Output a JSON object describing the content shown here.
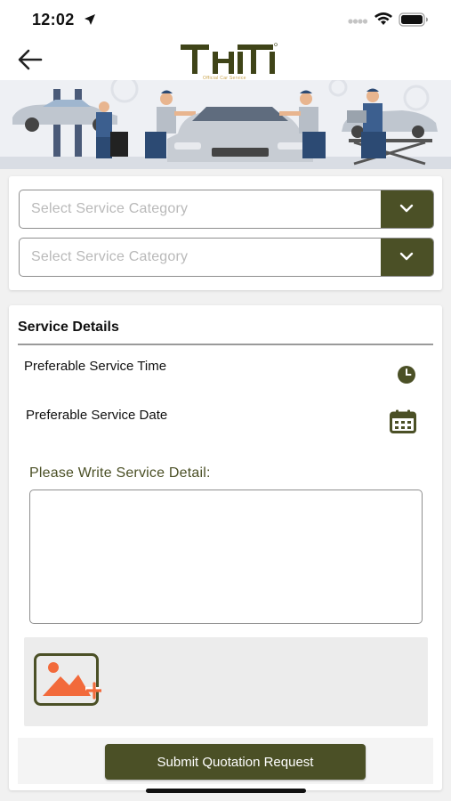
{
  "status_bar": {
    "time": "12:02"
  },
  "header": {
    "logo_text": "THT",
    "logo_tagline": "Official Car Service"
  },
  "categories": {
    "select_1_placeholder": "Select Service Category",
    "select_2_placeholder": "Select Service Category"
  },
  "service_details": {
    "title": "Service Details",
    "time_label": "Preferable Service Time",
    "date_label": "Preferable Service Date",
    "detail_label": "Please Write Service Detail:",
    "detail_value": ""
  },
  "submit": {
    "label": "Submit Quotation Request"
  },
  "colors": {
    "accent": "#4b5026",
    "logo": "#3f4418",
    "upload_icon_orange": "#f26a3b",
    "background": "#f1f1f1"
  }
}
